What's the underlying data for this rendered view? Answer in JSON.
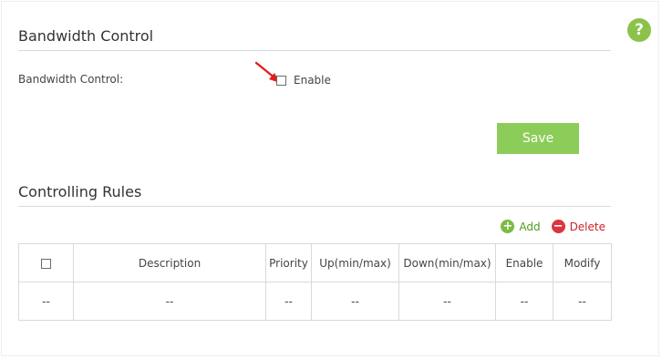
{
  "help": {
    "icon": "question-icon",
    "label": "?"
  },
  "bandwidth": {
    "title": "Bandwidth Control",
    "field_label": "Bandwidth Control:",
    "enable_label": "Enable",
    "enabled": false,
    "save_label": "Save"
  },
  "rules": {
    "title": "Controlling Rules",
    "add_label": "Add",
    "delete_label": "Delete",
    "columns": [
      "Description",
      "Priority",
      "Up(min/max)",
      "Down(min/max)",
      "Enable",
      "Modify"
    ],
    "rows": [
      [
        "--",
        "--",
        "--",
        "--",
        "--",
        "--",
        "--"
      ]
    ]
  },
  "colors": {
    "accent": "#8ccd5a",
    "add": "#7dbb41",
    "delete": "#d9363e",
    "annotation_arrow": "#e0201f"
  }
}
